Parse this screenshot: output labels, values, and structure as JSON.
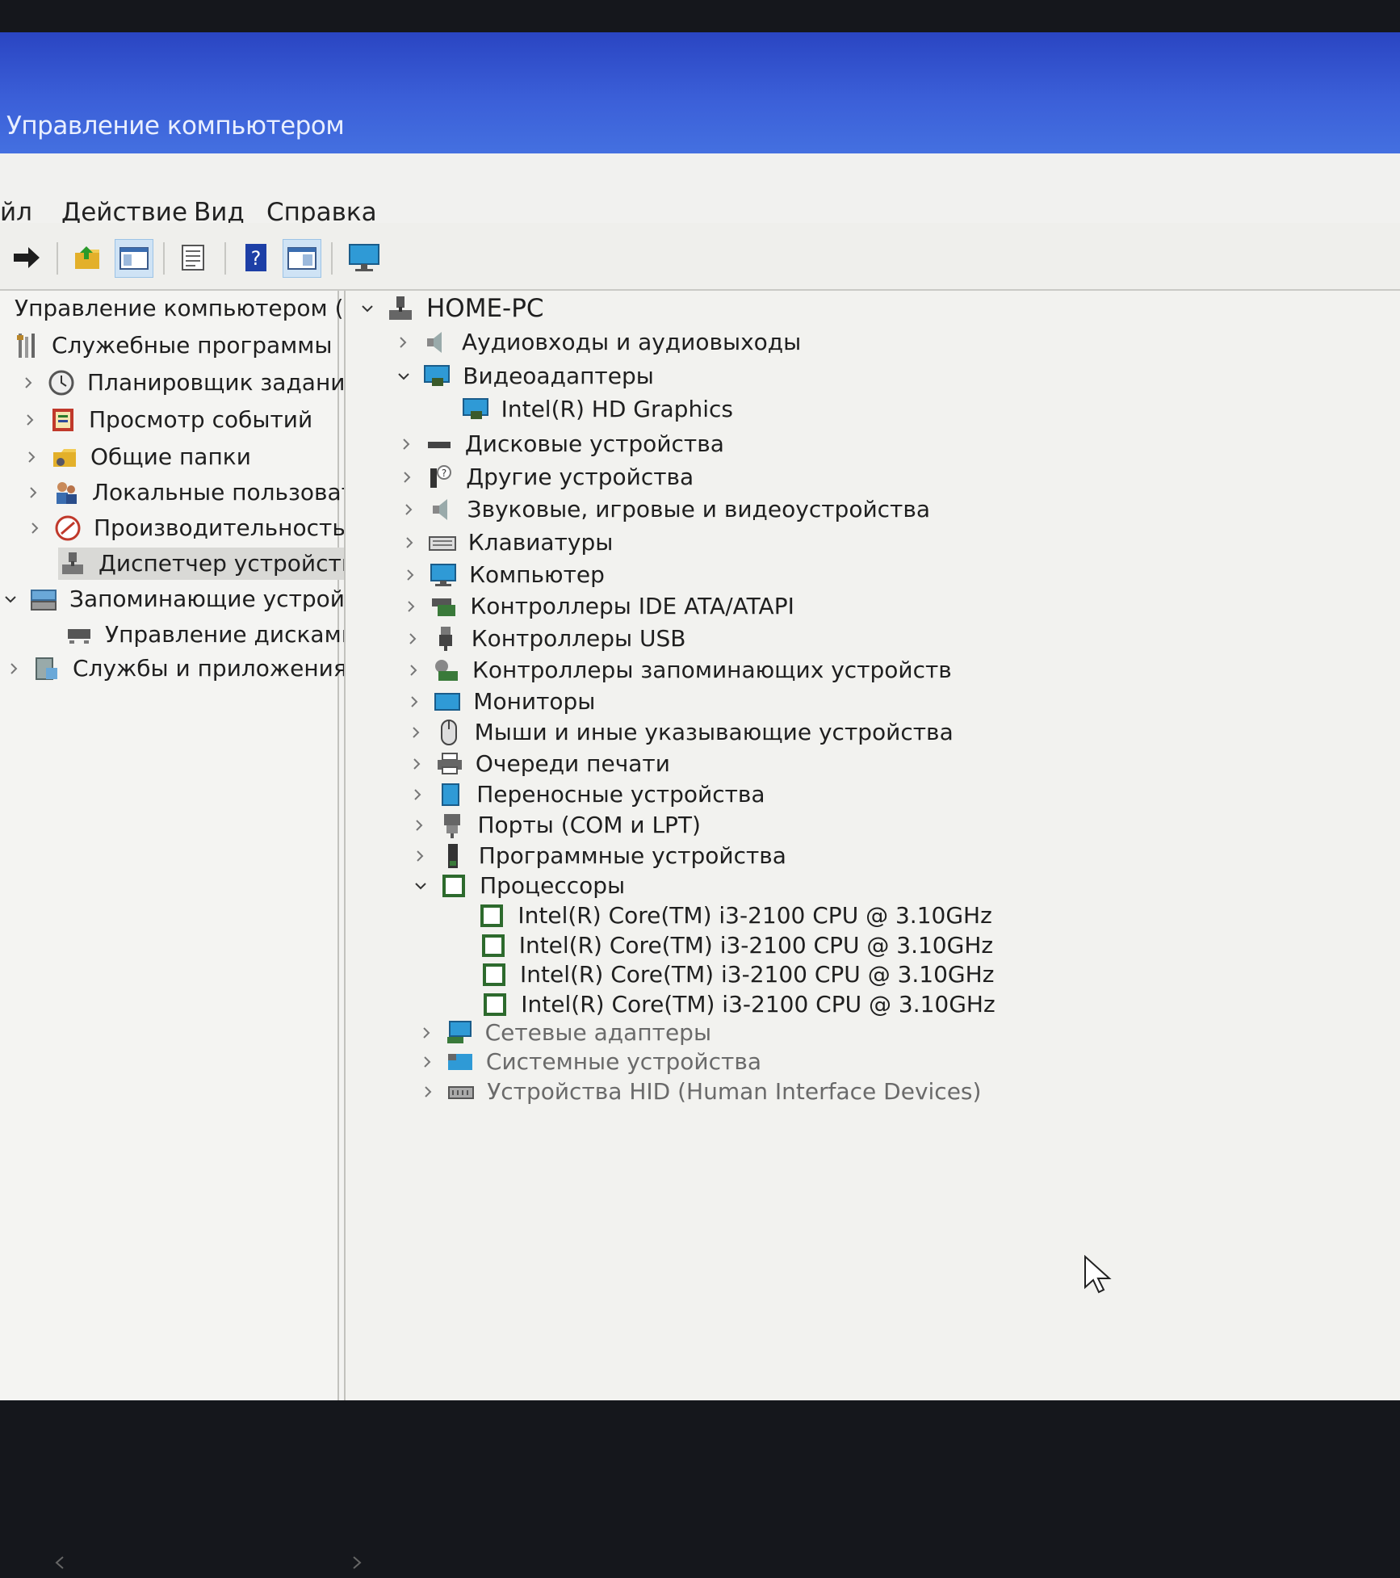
{
  "window": {
    "title": "Управление компьютером"
  },
  "menu": [
    "йл",
    "Действие",
    "Вид",
    "Справка"
  ],
  "toolbar": {
    "icons": [
      "forward-icon",
      "up-folder-icon",
      "show-tree-icon",
      "properties-icon",
      "help-icon",
      "view-icon",
      "monitor-icon"
    ]
  },
  "left_tree": [
    {
      "label": "Управление компьютером (л",
      "icon": "computer-management-icon",
      "expander": "none"
    },
    {
      "label": "Служебные программы",
      "icon": "tools-icon",
      "expander": "none"
    },
    {
      "label": "Планировщик заданий",
      "icon": "clock-icon",
      "expander": "right"
    },
    {
      "label": "Просмотр событий",
      "icon": "event-viewer-icon",
      "expander": "right"
    },
    {
      "label": "Общие папки",
      "icon": "shared-folder-icon",
      "expander": "right"
    },
    {
      "label": "Локальные пользовате",
      "icon": "users-icon",
      "expander": "right"
    },
    {
      "label": "Производительность",
      "icon": "performance-icon",
      "expander": "right"
    },
    {
      "label": "Диспетчер устройств",
      "icon": "device-manager-icon",
      "expander": "none",
      "selected": true
    },
    {
      "label": "Запоминающие устройст",
      "icon": "storage-icon",
      "expander": "down"
    },
    {
      "label": "Управление дисками",
      "icon": "disk-management-icon",
      "expander": "none"
    },
    {
      "label": "Службы и приложения",
      "icon": "services-icon",
      "expander": "right"
    }
  ],
  "device_tree": {
    "root": "HOME-PC",
    "categories": [
      {
        "label": "Аудиовходы и аудиовыходы",
        "icon": "speaker-icon",
        "expander": "right"
      },
      {
        "label": "Видеоадаптеры",
        "icon": "display-adapter-icon",
        "expander": "down"
      },
      {
        "label": "Intel(R) HD Graphics",
        "icon": "display-adapter-icon",
        "expander": "none",
        "child": true
      },
      {
        "label": "Дисковые устройства",
        "icon": "disk-drive-icon",
        "expander": "right"
      },
      {
        "label": "Другие устройства",
        "icon": "unknown-device-icon",
        "expander": "right"
      },
      {
        "label": "Звуковые, игровые и видеоустройства",
        "icon": "speaker-icon",
        "expander": "right"
      },
      {
        "label": "Клавиатуры",
        "icon": "keyboard-icon",
        "expander": "right"
      },
      {
        "label": "Компьютер",
        "icon": "computer-icon",
        "expander": "right"
      },
      {
        "label": "Контроллеры IDE ATA/ATAPI",
        "icon": "ide-controller-icon",
        "expander": "right"
      },
      {
        "label": "Контроллеры USB",
        "icon": "usb-icon",
        "expander": "right"
      },
      {
        "label": "Контроллеры запоминающих устройств",
        "icon": "storage-controller-icon",
        "expander": "right"
      },
      {
        "label": "Мониторы",
        "icon": "monitor-icon",
        "expander": "right"
      },
      {
        "label": "Мыши и иные указывающие устройства",
        "icon": "mouse-icon",
        "expander": "right"
      },
      {
        "label": "Очереди печати",
        "icon": "printer-icon",
        "expander": "right"
      },
      {
        "label": "Переносные устройства",
        "icon": "portable-device-icon",
        "expander": "right"
      },
      {
        "label": "Порты (COM и LPT)",
        "icon": "port-icon",
        "expander": "right"
      },
      {
        "label": "Программные устройства",
        "icon": "software-device-icon",
        "expander": "right"
      },
      {
        "label": "Процессоры",
        "icon": "processor-icon",
        "expander": "down"
      },
      {
        "label": "Intel(R) Core(TM) i3-2100 CPU @ 3.10GHz",
        "icon": "processor-icon",
        "expander": "none",
        "child": true
      },
      {
        "label": "Intel(R) Core(TM) i3-2100 CPU @ 3.10GHz",
        "icon": "processor-icon",
        "expander": "none",
        "child": true
      },
      {
        "label": "Intel(R) Core(TM) i3-2100 CPU @ 3.10GHz",
        "icon": "processor-icon",
        "expander": "none",
        "child": true
      },
      {
        "label": "Intel(R) Core(TM) i3-2100 CPU @ 3.10GHz",
        "icon": "processor-icon",
        "expander": "none",
        "child": true
      },
      {
        "label": "Сетевые адаптеры",
        "icon": "network-adapter-icon",
        "expander": "right"
      },
      {
        "label": "Системные устройства",
        "icon": "system-device-icon",
        "expander": "right"
      },
      {
        "label": "Устройства HID (Human Interface Devices)",
        "icon": "hid-icon",
        "expander": "right"
      }
    ]
  }
}
